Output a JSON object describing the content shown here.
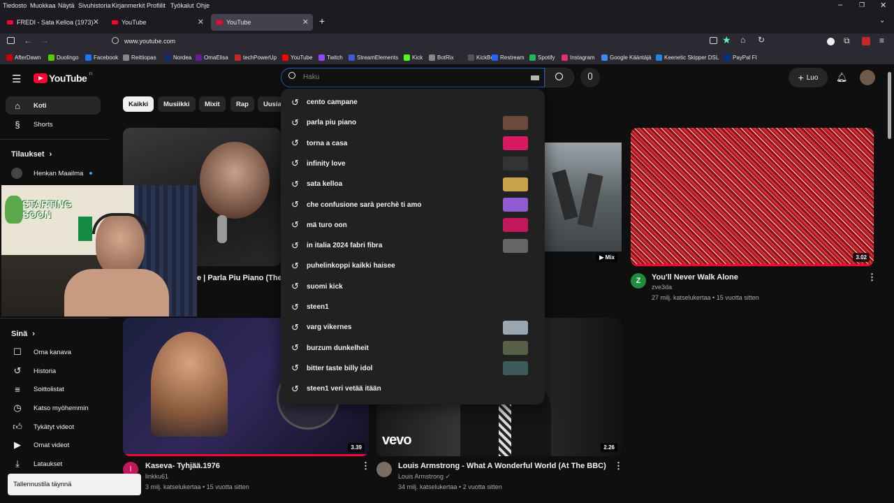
{
  "browser": {
    "menu": [
      "Tiedosto",
      "Muokkaa",
      "Näytä",
      "Sivuhistoria",
      "Kirjanmerkit",
      "Profiilit",
      "Työkalut",
      "Ohje"
    ],
    "tabs": [
      {
        "title": "FREDI - Sata Kelloa (1973) - You"
      },
      {
        "title": "YouTube"
      },
      {
        "title": "YouTube"
      }
    ],
    "url": "www.youtube.com",
    "bookmarks": [
      "AfterDawn",
      "Duolingo",
      "Facebook",
      "Reittiopas",
      "Nordea",
      "OmaElisa",
      "techPowerUp",
      "YouTube",
      "Twitch",
      "StreamElements",
      "Kick",
      "BotRix",
      "KickBot",
      "Restream",
      "Spotify",
      "Instagram",
      "Google Kääntäjä",
      "Keenetic Skipper DSL",
      "PayPal FI"
    ],
    "bookmark_colors": [
      "#c00",
      "#58cc02",
      "#1877f2",
      "#888",
      "#0a2d6e",
      "#6a1b9a",
      "#c62828",
      "#f00",
      "#9146ff",
      "#3b5bdb",
      "#53fc18",
      "#888",
      "#555",
      "#2962ff",
      "#1db954",
      "#e1306c",
      "#4285f4",
      "#1e88e5",
      "#003087"
    ]
  },
  "youtube": {
    "logo_text": "YouTube",
    "logo_region": "FI",
    "search_placeholder": "Haku",
    "create_label": "Luo",
    "sidebar": {
      "home": "Koti",
      "shorts": "Shorts",
      "subscriptions": "Tilaukset",
      "subscription_channel": "Henkan Maailma",
      "you": "Sinä",
      "you_items": [
        "Oma kanava",
        "Historia",
        "Soittolistat",
        "Katso myöhemmin",
        "Tykätyt videot",
        "Omat videot",
        "Lataukset"
      ]
    },
    "chips": [
      "Kaikki",
      "Musiikki",
      "Mixit",
      "Rap",
      "Uusia"
    ],
    "suggestions": [
      "cento campane",
      "parla piu piano",
      "torna a casa",
      "infinity love",
      "sata kelloa",
      "che confusione sarà perchè ti amo",
      "mä turo oon",
      "in italia 2024 fabri fibra",
      "puhelinkoppi kaikki haisee",
      "suomi kick",
      "steen1",
      "varg vikernes",
      "burzum dunkelheit",
      "bitter taste billy idol",
      "steen1 veri vetää itään"
    ],
    "videos": [
      {
        "title_partial": "e | Parla Piu Piano (The C"
      },
      {
        "badge": "Mix"
      },
      {
        "title": "You'll Never Walk Alone",
        "channel": "zve3da",
        "channel_initial": "Z",
        "meta": "27 milj. katselukertaa • 15 vuotta sitten",
        "duration": "3.02"
      },
      {
        "title": "Kaseva- Tyhjää.1976",
        "channel": "linkku61",
        "channel_initial": "l",
        "meta": "3 milj. katselukertaa • 15 vuotta sitten",
        "duration": "3.39"
      },
      {
        "title": "Louis Armstrong - What A Wonderful World (At The BBC)",
        "channel": "Louis Armstrong",
        "meta": "34 milj. katselukertaa • 2 vuotta sitten",
        "duration": "2.26",
        "watermark": "vevo"
      }
    ],
    "webcam_sign": "STARTING SOON",
    "toast": "Tallennustila täynnä"
  },
  "colors": {
    "accent_red": "#ff0033",
    "zve3da_avatar": "#1e8e3e",
    "linkku_avatar": "#c2185b"
  }
}
